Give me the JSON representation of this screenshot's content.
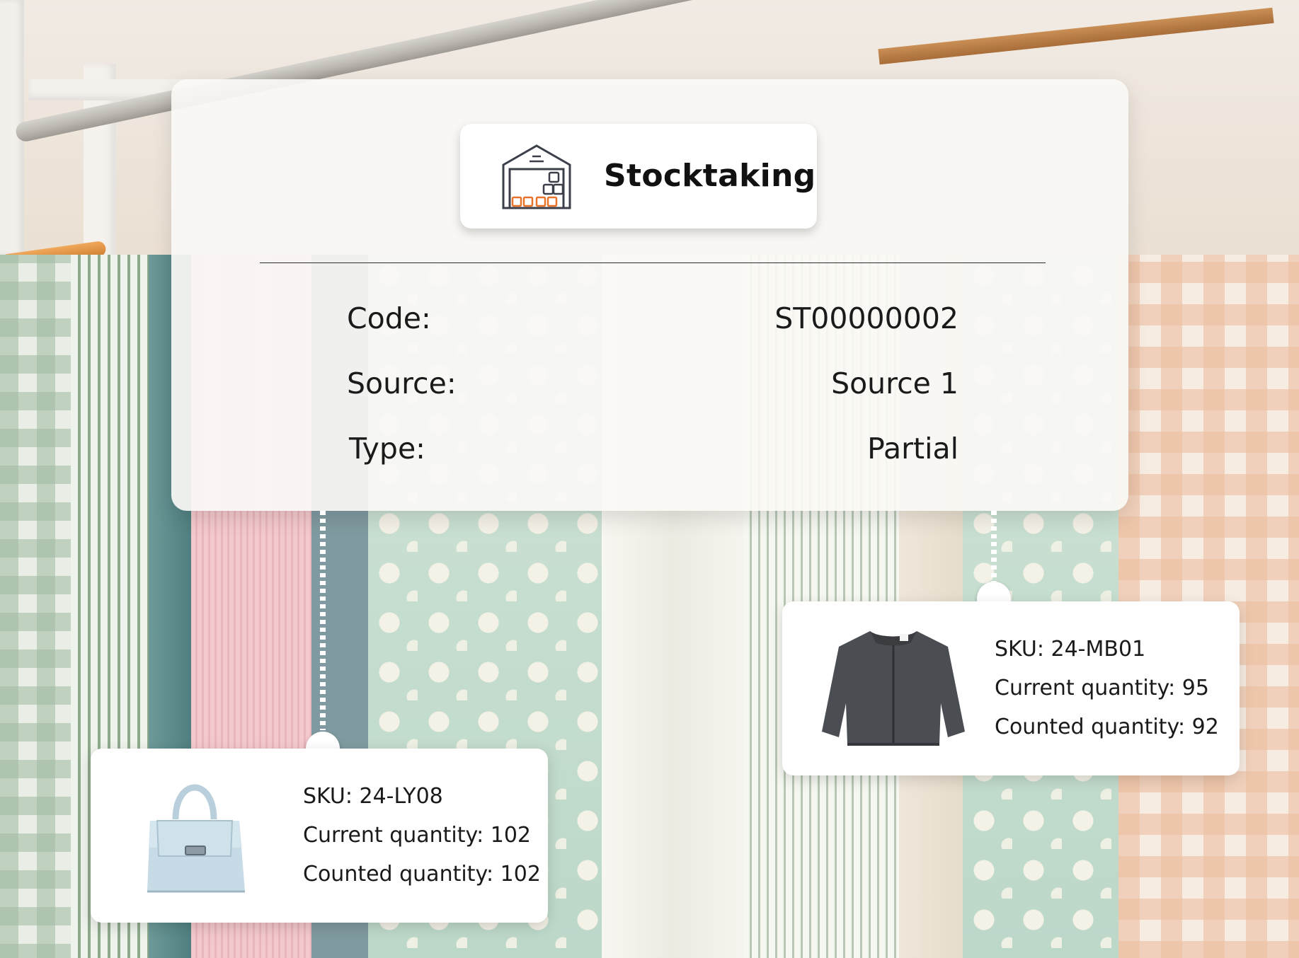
{
  "stocktaking": {
    "title": "Stocktaking",
    "icon": "warehouse-icon",
    "fields": [
      {
        "label": "Code:",
        "value": "ST00000002"
      },
      {
        "label": "Source:",
        "value": "Source 1"
      },
      {
        "label": "Type:",
        "value": "Partial"
      }
    ]
  },
  "products": [
    {
      "sku": "SKU: 24-LY08",
      "current": "Current quantity: 102",
      "counted": "Counted quantity: 102",
      "image": "handbag-icon"
    },
    {
      "sku": "SKU: 24-MB01",
      "current": "Current quantity: 95",
      "counted": "Counted quantity: 92",
      "image": "jacket-icon"
    }
  ],
  "colors": {
    "card_background": "#faf8f5",
    "text": "#1a1a1a",
    "icon_accent": "#e8742c",
    "icon_outline": "#3b3f4a"
  }
}
